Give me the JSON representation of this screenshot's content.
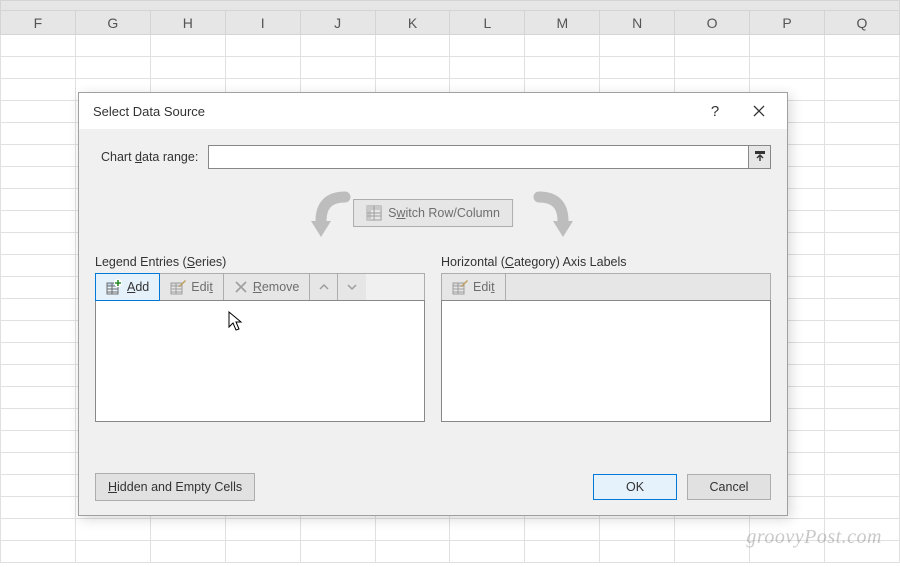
{
  "spreadsheet": {
    "columns": [
      "F",
      "G",
      "H",
      "I",
      "J",
      "K",
      "L",
      "M",
      "N",
      "O",
      "P",
      "Q"
    ]
  },
  "dialog": {
    "title": "Select Data Source",
    "range_label_pre": "Chart ",
    "range_label_u": "d",
    "range_label_post": "ata range:",
    "range_value": "",
    "switch_pre": "S",
    "switch_u": "w",
    "switch_post": "itch Row/Column",
    "legend": {
      "label_pre": "Legend Entries (",
      "label_u": "S",
      "label_post": "eries)",
      "add_u": "A",
      "add_post": "dd",
      "edit_pre": "Edi",
      "edit_u": "t",
      "remove_u": "R",
      "remove_post": "emove"
    },
    "axis": {
      "label_pre": "Horizontal (",
      "label_u": "C",
      "label_post": "ategory) Axis Labels",
      "edit_pre": "Edi",
      "edit_u": "t"
    },
    "hidden_btn_u": "H",
    "hidden_btn_post": "idden and Empty Cells",
    "ok": "OK",
    "cancel": "Cancel"
  },
  "watermark": "groovyPost.com"
}
